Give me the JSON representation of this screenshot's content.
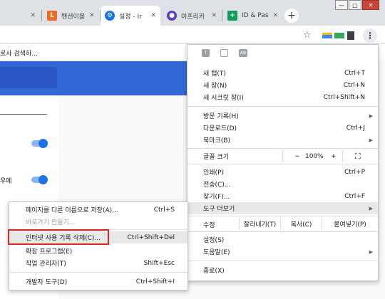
{
  "tabs": [
    {
      "title": "",
      "fav_color": "#dee1e6"
    },
    {
      "title": "팬션이용",
      "fav_color": "#f16a22",
      "fav_text": "L"
    },
    {
      "title": "설정 - Ir",
      "fav_color": "#1a73e8",
      "fav_text": "⚙",
      "active": true
    },
    {
      "title": "아프리카",
      "fav_color": "#5b3fc4",
      "fav_text": "●"
    },
    {
      "title": "ID & Pas",
      "fav_color": "#0f9d58",
      "fav_text": "+"
    }
  ],
  "new_tab": "+",
  "window_buttons": {
    "minimize": "—",
    "maximize": "□",
    "close": "✕"
  },
  "bookmark_text": "로사 검색하...",
  "settings_side": {
    "label": "우에"
  },
  "main_menu": {
    "items": [
      {
        "label": "새 탭(T)",
        "shortcut": "Ctrl+T"
      },
      {
        "label": "새 창(N)",
        "shortcut": "Ctrl+N"
      },
      {
        "label": "새 시크릿 창(I)",
        "shortcut": "Ctrl+Shift+N"
      },
      {
        "label": "방문 기록(H)",
        "submenu": true
      },
      {
        "label": "다운로드(D)",
        "shortcut": "Ctrl+J"
      },
      {
        "label": "북마크(B)",
        "submenu": true
      },
      {
        "label": "글꼴 크기"
      },
      {
        "label": "인쇄(P)",
        "shortcut": "Ctrl+P"
      },
      {
        "label": "전송(C)..."
      },
      {
        "label": "찾기(F)...",
        "shortcut": "Ctrl+F"
      },
      {
        "label": "도구 더보기",
        "submenu": true,
        "highlighted": true
      },
      {
        "label": "수정"
      },
      {
        "label": "설정(S)"
      },
      {
        "label": "도움말(E)",
        "submenu": true
      },
      {
        "label": "종료(X)"
      }
    ],
    "zoom": {
      "minus": "−",
      "value": "100%",
      "plus": "+",
      "fullscreen": "⛶"
    },
    "edit": {
      "cut": "잘라내기(T)",
      "copy": "복사(C)",
      "paste": "붙여넣기(P)"
    }
  },
  "submenu": {
    "items": [
      {
        "label": "페이지를 다른 이름으로 저장(A)...",
        "shortcut": "Ctrl+S"
      },
      {
        "label": "바로가기 만들기...",
        "disabled": true
      },
      {
        "label": "인터넷 사용 기록 삭제(C)...",
        "shortcut": "Ctrl+Shift+Del",
        "highlighted": true
      },
      {
        "label": "확장 프로그램(E)"
      },
      {
        "label": "작업 관리자(T)",
        "shortcut": "Shift+Esc"
      },
      {
        "label": "개발자 도구(D)",
        "shortcut": "Ctrl+Shift+I"
      }
    ]
  },
  "colors": {
    "accent": "#3367d6",
    "highlight_box": "#e0251b",
    "toggle": "#1a73e8"
  }
}
